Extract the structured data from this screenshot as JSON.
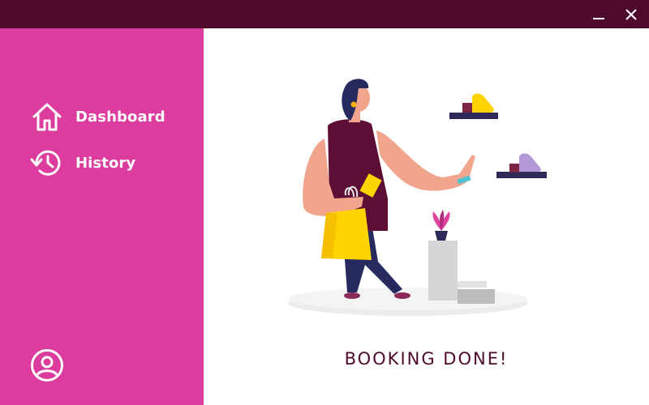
{
  "window": {
    "controls": [
      {
        "name": "minimize-icon"
      },
      {
        "name": "close-icon"
      }
    ]
  },
  "sidebar": {
    "items": [
      {
        "label": "Dashboard",
        "icon": "home-icon"
      },
      {
        "label": "History",
        "icon": "history-icon"
      }
    ],
    "footer_icon": "user-account-icon"
  },
  "main": {
    "status": "BOOKING DONE!",
    "illustration": "woman-shopping-shoes-illustration"
  },
  "colors": {
    "titlebar": "#4e0a2b",
    "sidebar": "#dc3c9e",
    "accent_text": "#4e0a2b",
    "background": "#ffffff"
  }
}
